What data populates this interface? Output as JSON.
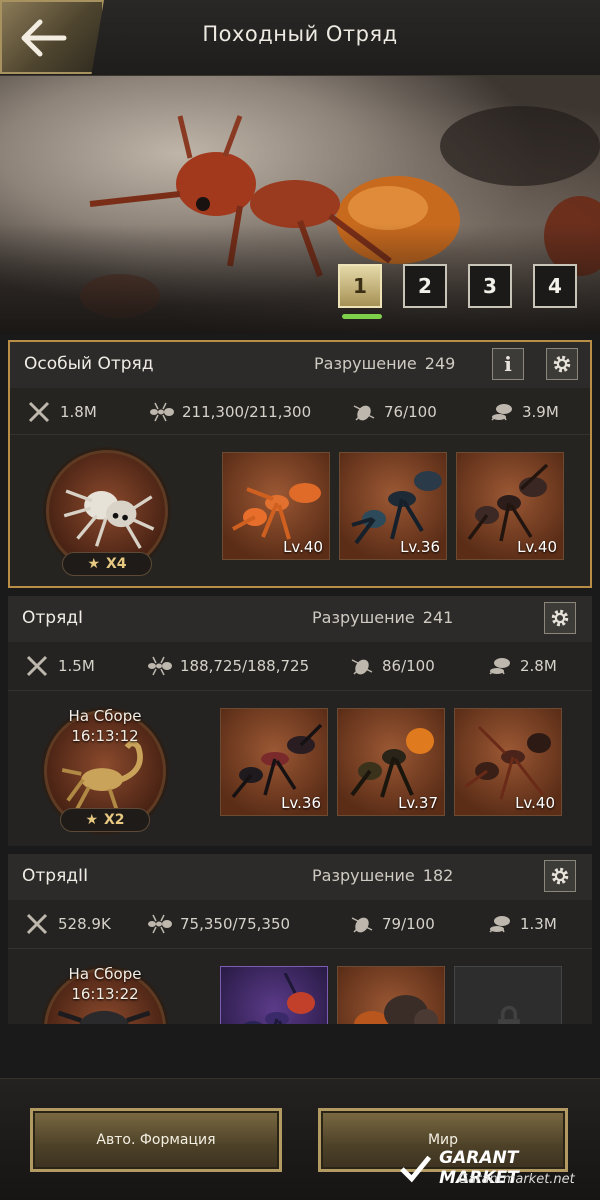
{
  "header": {
    "title": "Походный Отряд",
    "back_icon": "arrow-left-icon"
  },
  "tabs": [
    {
      "label": "1",
      "active": true
    },
    {
      "label": "2",
      "active": false
    },
    {
      "label": "3",
      "active": false
    },
    {
      "label": "4",
      "active": false
    }
  ],
  "squads": [
    {
      "name": "Особый Отряд",
      "destruction_label": "Разрушение",
      "destruction_value": "249",
      "info_label": "i",
      "stats": {
        "power": "1.8M",
        "troops": "211,300/211,300",
        "capacity": "76/100",
        "load": "3.9M"
      },
      "hero": {
        "status": "",
        "time": "",
        "stars": "X4"
      },
      "units": [
        {
          "level": "Lv.40"
        },
        {
          "level": "Lv.36"
        },
        {
          "level": "Lv.40"
        }
      ]
    },
    {
      "name": "ОтрядI",
      "destruction_label": "Разрушение",
      "destruction_value": "241",
      "stats": {
        "power": "1.5M",
        "troops": "188,725/188,725",
        "capacity": "86/100",
        "load": "2.8M"
      },
      "hero": {
        "status": "На Сборе",
        "time": "16:13:12",
        "stars": "X2"
      },
      "units": [
        {
          "level": "Lv.36"
        },
        {
          "level": "Lv.37"
        },
        {
          "level": "Lv.40"
        }
      ]
    },
    {
      "name": "ОтрядII",
      "destruction_label": "Разрушение",
      "destruction_value": "182",
      "stats": {
        "power": "528.9K",
        "troops": "75,350/75,350",
        "capacity": "79/100",
        "load": "1.3M"
      },
      "hero": {
        "status": "На Сборе",
        "time": "16:13:22"
      },
      "units": [
        {
          "level": ""
        },
        {
          "level": ""
        },
        {
          "level": ""
        }
      ]
    }
  ],
  "footer": {
    "auto_formation_label": "Авто. Формация",
    "world_label": "Мир"
  },
  "watermark": {
    "title": "GARANT MARKET",
    "url": "Garantmarket.net"
  },
  "colors": {
    "accent_gold": "#b98e46",
    "tab_indicator": "#7ed04a"
  }
}
